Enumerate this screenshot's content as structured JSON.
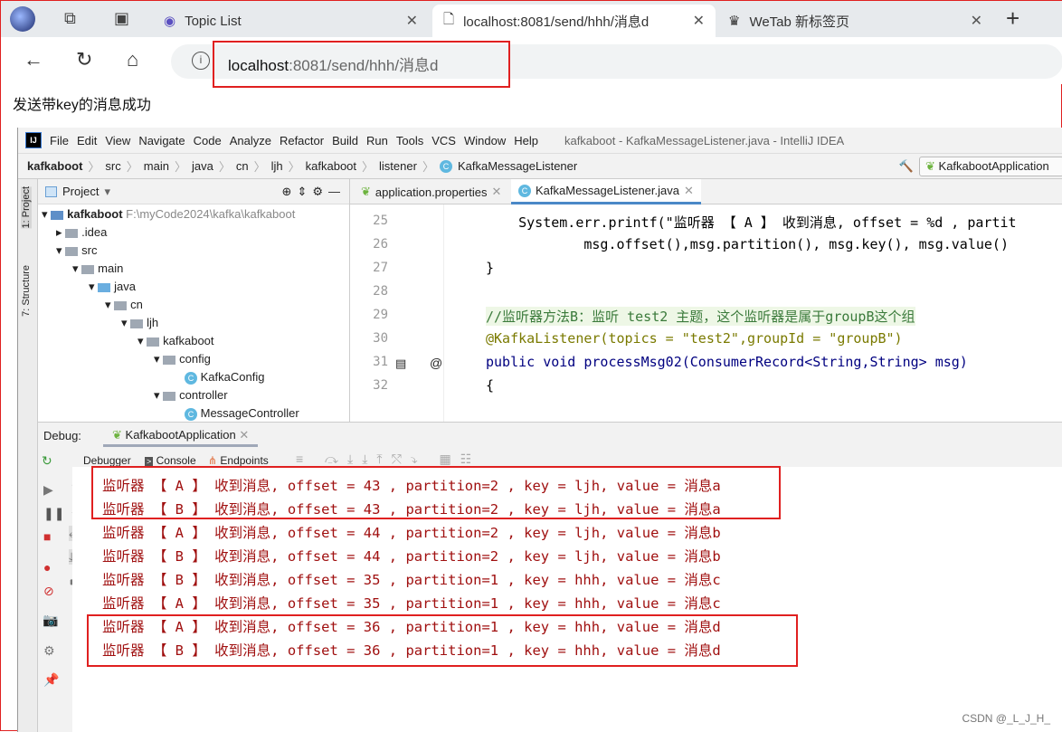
{
  "browser": {
    "tabs": [
      {
        "label": "Topic List",
        "active": false
      },
      {
        "label": "localhost:8081/send/hhh/消息d",
        "active": true
      },
      {
        "label": "WeTab 新标签页",
        "active": false
      }
    ],
    "new_tab": "+",
    "url_host": "localhost",
    "url_rest": ":8081/send/hhh/消息d"
  },
  "page": {
    "message": "发送带key的消息成功"
  },
  "ide": {
    "logo": "IJ",
    "menu": [
      "File",
      "Edit",
      "View",
      "Navigate",
      "Code",
      "Analyze",
      "Refactor",
      "Build",
      "Run",
      "Tools",
      "VCS",
      "Window",
      "Help"
    ],
    "window_title": "kafkaboot - KafkaMessageListener.java - IntelliJ IDEA",
    "breadcrumbs": [
      "kafkaboot",
      "src",
      "main",
      "java",
      "cn",
      "ljh",
      "kafkaboot",
      "listener",
      "KafkaMessageListener"
    ],
    "run_config": "KafkabootApplication",
    "side_tabs": [
      "1: Project",
      "7: Structure"
    ],
    "project": {
      "title": "Project",
      "root": "kafkaboot",
      "root_path": "F:\\myCode2024\\kafka\\kafkaboot",
      "items": [
        ".idea",
        "src",
        "main",
        "java",
        "cn",
        "ljh",
        "kafkaboot",
        "config",
        "KafkaConfig",
        "controller",
        "MessageController"
      ]
    },
    "editor": {
      "tabs": [
        "application.properties",
        "KafkaMessageListener.java"
      ],
      "line_numbers": [
        "25",
        "26",
        "27",
        "28",
        "29",
        "30",
        "31",
        "32"
      ],
      "lines": [
        "    System.err.printf(\"监听器 【 A 】 收到消息, offset = %d , partit",
        "            msg.offset(),msg.partition(), msg.key(), msg.value()",
        "}",
        "",
        "//监听器方法B：监听 test2 主题，这个监听器是属于groupB这个组",
        "@KafkaListener(topics = \"test2\",groupId = \"groupB\")",
        "public void processMsg02(ConsumerRecord<String,String> msg)",
        "{"
      ]
    },
    "debug": {
      "label": "Debug:",
      "session": "KafkabootApplication",
      "tabs": [
        "Debugger",
        "Console",
        "Endpoints"
      ],
      "console": [
        "监听器 【 A 】 收到消息, offset = 43 , partition=2 , key = ljh, value = 消息a",
        "监听器 【 B 】 收到消息, offset = 43 , partition=2 , key = ljh, value = 消息a",
        "监听器 【 A 】 收到消息, offset = 44 , partition=2 , key = ljh, value = 消息b",
        "监听器 【 B 】 收到消息, offset = 44 , partition=2 , key = ljh, value = 消息b",
        "监听器 【 B 】 收到消息, offset = 35 , partition=1 , key = hhh, value = 消息c",
        "监听器 【 A 】 收到消息, offset = 35 , partition=1 , key = hhh, value = 消息c",
        "监听器 【 A 】 收到消息, offset = 36 , partition=1 , key = hhh, value = 消息d",
        "监听器 【 B 】 收到消息, offset = 36 , partition=1 , key = hhh, value = 消息d"
      ]
    }
  },
  "watermark": "CSDN @_L_J_H_",
  "colors": {
    "highlight": "#e02020",
    "console_text": "#a01010",
    "accent": "#4a88c7"
  }
}
